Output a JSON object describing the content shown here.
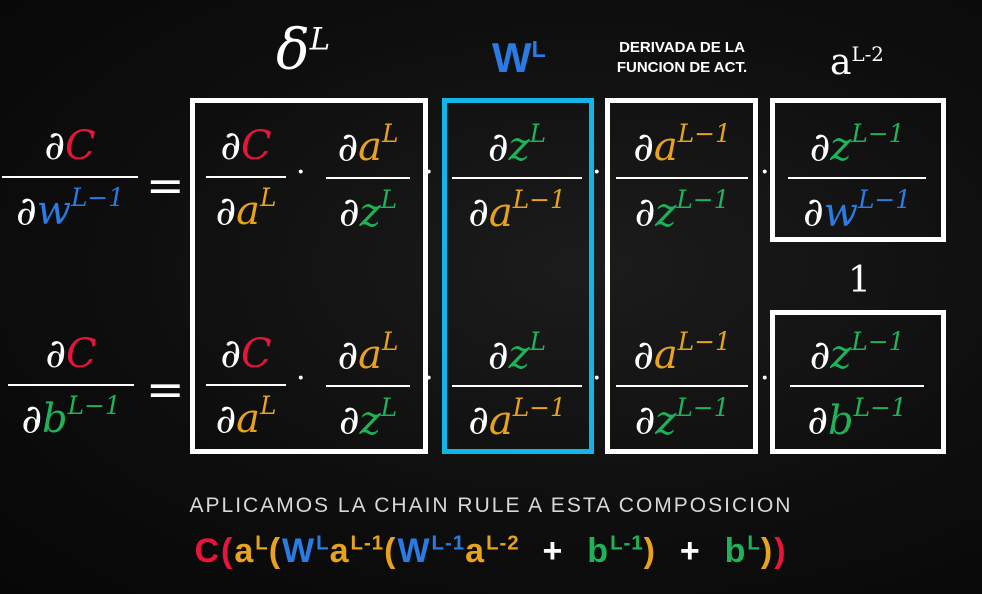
{
  "headers": {
    "delta": "δ",
    "delta_sup": "L",
    "w": "W",
    "w_sup": "L",
    "deriv_line1": "DERIVADA DE LA",
    "deriv_line2": "FUNCION DE ACT.",
    "a": "a",
    "a_sup": "L-2"
  },
  "one_label": "1",
  "caption": "APLICAMOS LA CHAIN RULE A ESTA COMPOSICION",
  "colors": {
    "cost": "#e8143c",
    "weight": "#2b7be4",
    "activation": "#e8a31b",
    "z_and_bias": "#1fb25a",
    "box_highlight": "#12b6e6"
  }
}
